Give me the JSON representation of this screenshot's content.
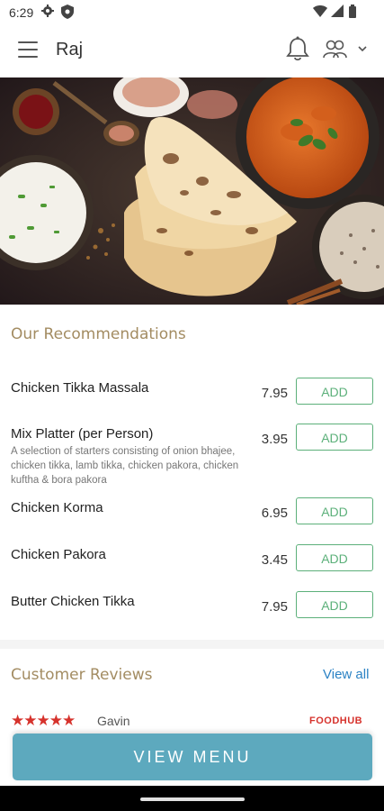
{
  "status": {
    "time": "6:29"
  },
  "header": {
    "restaurant_name": "Raj"
  },
  "recommendations": {
    "title": "Our Recommendations",
    "items": [
      {
        "name": "Chicken Tikka Massala",
        "description": "",
        "price": "7.95",
        "button": "ADD"
      },
      {
        "name": "Mix Platter (per Person)",
        "description": "A selection of starters consisting of onion bhajee, chicken tikka, lamb tikka, chicken pakora, chicken kuftha & bora pakora",
        "price": "3.95",
        "button": "ADD"
      },
      {
        "name": "Chicken Korma",
        "description": "",
        "price": "6.95",
        "button": "ADD"
      },
      {
        "name": "Chicken Pakora",
        "description": "",
        "price": "3.45",
        "button": "ADD"
      },
      {
        "name": "Butter Chicken Tikka",
        "description": "",
        "price": "7.95",
        "button": "ADD"
      }
    ]
  },
  "reviews": {
    "title": "Customer Reviews",
    "view_all": "View all",
    "first": {
      "stars": "★★★★★",
      "reviewer": "Gavin",
      "source": "FOODHUB"
    }
  },
  "cta": {
    "label": "VIEW MENU"
  },
  "colors": {
    "accent_gold": "#a38c62",
    "add_green": "#5cb07a",
    "cta_blue": "#5da9be",
    "link_blue": "#2b82c4",
    "star_red": "#d6322c"
  }
}
